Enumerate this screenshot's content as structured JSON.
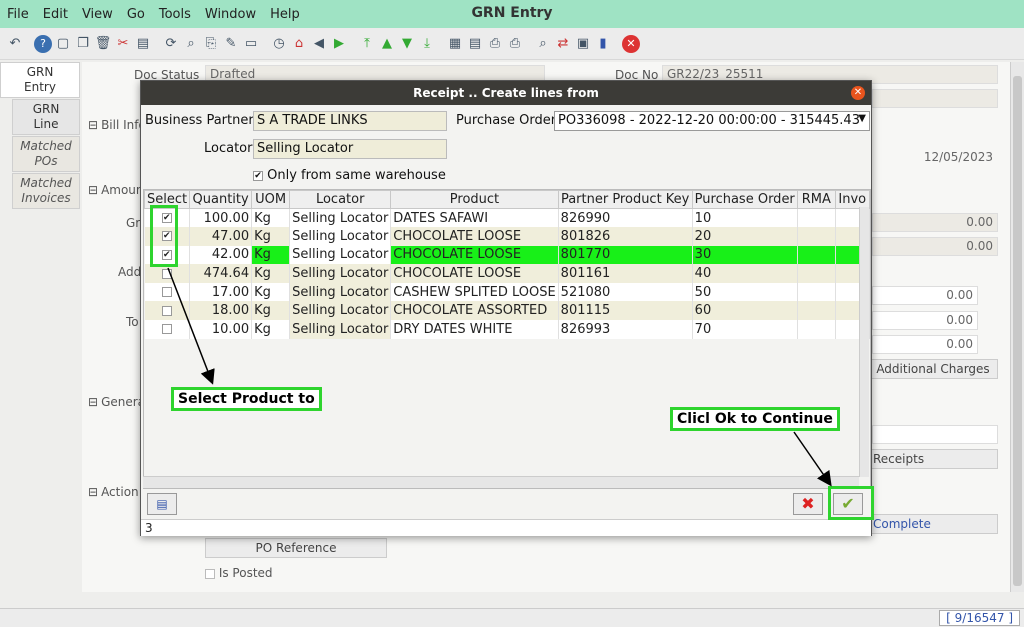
{
  "app": {
    "title": "GRN Entry",
    "menu": [
      "File",
      "Edit",
      "View",
      "Go",
      "Tools",
      "Window",
      "Help"
    ]
  },
  "left_tabs": [
    {
      "label": "GRN\nEntry"
    },
    {
      "label": "GRN\nLine"
    },
    {
      "label": "Matched\nPOs"
    },
    {
      "label": "Matched\nInvoices"
    }
  ],
  "bg": {
    "doc_status_label": "Doc Status",
    "doc_status_value": "Drafted",
    "doc_no_label": "Doc No",
    "doc_no_value": "GR22/23_25511",
    "bill_info": "Bill Info",
    "amounts": "Amounts",
    "date_value": "12/05/2023",
    "zero1": "0.00",
    "zero2": "0.00",
    "zero3": "0.00",
    "zero4": "0.00",
    "zero5": "0.00",
    "gr_label": "Gr",
    "add_label": "Add",
    "to_label": "To",
    "general": "General",
    "action": "Action",
    "additional_charges": "Additional Charges",
    "receipts": "Receipts",
    "complete": "Complete",
    "po_reference": "PO Reference",
    "is_posted": "Is Posted",
    "record_count": "[  9/16547 ]"
  },
  "dialog": {
    "title": "Receipt .. Create lines from",
    "business_partner_label": "Business Partner",
    "business_partner_value": "S A TRADE LINKS",
    "purchase_order_label": "Purchase Order",
    "purchase_order_value": "PO336098 - 2022-12-20 00:00:00 - 315445.43",
    "locator_label": "Locator",
    "locator_value": "Selling Locator",
    "same_warehouse_label": "Only from same warehouse",
    "status_count": "3",
    "columns": [
      "Select",
      "Quantity",
      "UOM",
      "Locator",
      "Product",
      "Partner Product Key",
      "Purchase Order",
      "RMA",
      "Invo"
    ],
    "rows": [
      {
        "checked": "✔",
        "qty": "100.00",
        "uom": "Kg",
        "locator": "Selling Locator",
        "product": "DATES SAFAWI",
        "key": "826990",
        "po": "10"
      },
      {
        "checked": "✔",
        "qty": "47.00",
        "uom": "Kg",
        "locator": "Selling Locator",
        "product": "CHOCOLATE LOOSE",
        "key": "801826",
        "po": "20"
      },
      {
        "checked": "✔",
        "qty": "42.00",
        "uom": "Kg",
        "locator": "Selling Locator",
        "product": "CHOCOLATE LOOSE",
        "key": "801770",
        "po": "30"
      },
      {
        "checked": "",
        "qty": "474.64",
        "uom": "Kg",
        "locator": "Selling Locator",
        "product": "CHOCOLATE LOOSE",
        "key": "801161",
        "po": "40"
      },
      {
        "checked": "",
        "qty": "17.00",
        "uom": "Kg",
        "locator": "Selling Locator",
        "product": "CASHEW SPLITED LOOSE",
        "key": "521080",
        "po": "50"
      },
      {
        "checked": "",
        "qty": "18.00",
        "uom": "Kg",
        "locator": "Selling Locator",
        "product": "CHOCOLATE  ASSORTED",
        "key": "801115",
        "po": "60"
      },
      {
        "checked": "",
        "qty": "10.00",
        "uom": "Kg",
        "locator": "Selling Locator",
        "product": "DRY DATES WHITE",
        "key": "826993",
        "po": "70"
      }
    ]
  },
  "annotations": {
    "select_product": "Select Product to",
    "click_ok": "Clicl Ok to Continue"
  },
  "colors": {
    "menubar": "#9fe3c4",
    "highlight": "#2ed42e",
    "selected_row": "#18f018",
    "dialog_title": "#3c3b37"
  }
}
